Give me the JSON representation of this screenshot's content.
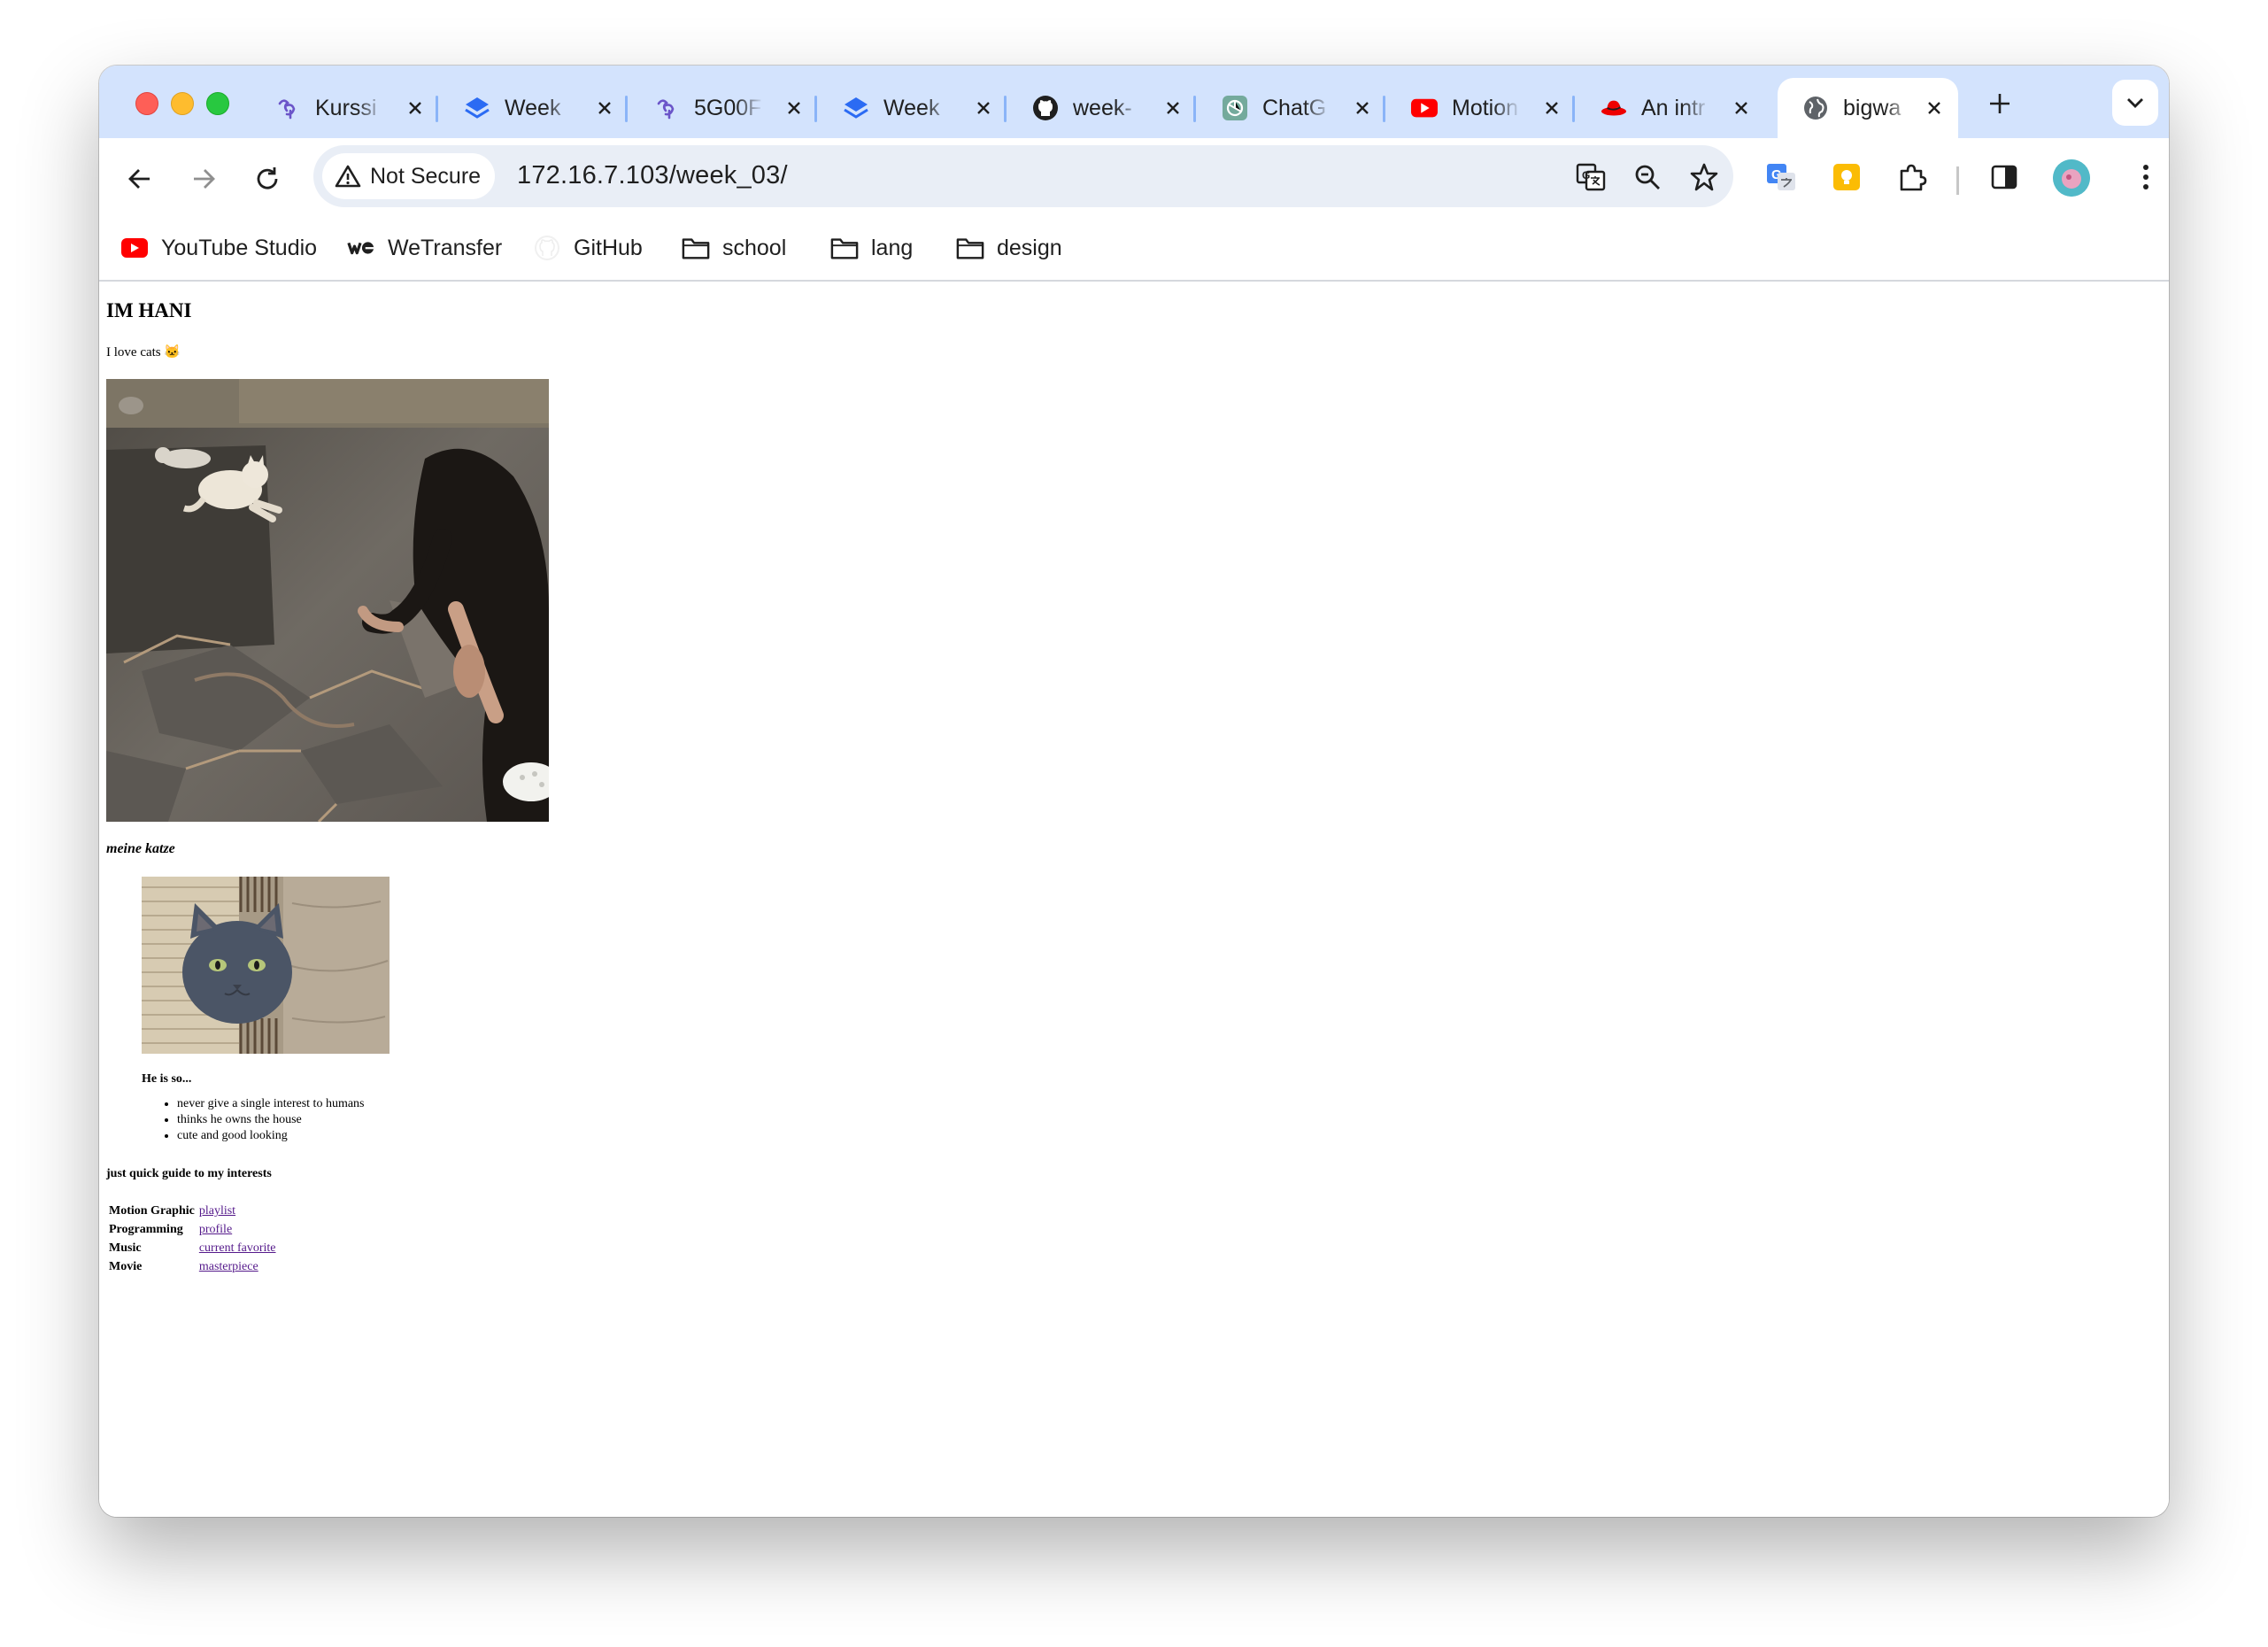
{
  "browser": {
    "tabs": [
      {
        "title": "Kurssi",
        "icon": "sisu-icon"
      },
      {
        "title": "Week",
        "icon": "layers-icon"
      },
      {
        "title": "5G00F",
        "icon": "sisu-icon"
      },
      {
        "title": "Week",
        "icon": "layers-icon"
      },
      {
        "title": "week-",
        "icon": "github-icon"
      },
      {
        "title": "ChatG",
        "icon": "chatgpt-icon"
      },
      {
        "title": "Motion",
        "icon": "youtube-icon"
      },
      {
        "title": "An intr",
        "icon": "redhat-icon"
      },
      {
        "title": "bigwa",
        "icon": "globe-icon",
        "active": true
      }
    ],
    "security_label": "Not Secure",
    "url": "172.16.7.103/week_03/",
    "bookmarks": [
      {
        "label": "YouTube Studio",
        "icon": "youtube-studio-icon"
      },
      {
        "label": "WeTransfer",
        "icon": "wetransfer-icon"
      },
      {
        "label": "GitHub",
        "icon": "github-icon"
      },
      {
        "label": "school",
        "icon": "folder-icon"
      },
      {
        "label": "lang",
        "icon": "folder-icon"
      },
      {
        "label": "design",
        "icon": "folder-icon"
      }
    ],
    "colors": {
      "tabstrip": "#d3e3fd",
      "omnibox": "#e9eef6",
      "link_visited": "#551a8b"
    }
  },
  "page": {
    "heading": "IM HANI",
    "intro": "I love cats 🐱",
    "photo1_caption": "meine katze",
    "photo2_caption": "He is so...",
    "traits": [
      "never give a single interest to humans",
      "thinks he owns the house",
      "cute and good looking"
    ],
    "guide_title": "just quick guide to my interests",
    "interests": [
      {
        "label": "Motion Graphic",
        "link": "playlist"
      },
      {
        "label": "Programming",
        "link": "profile"
      },
      {
        "label": "Music",
        "link": "current favorite"
      },
      {
        "label": "Movie",
        "link": "masterpiece"
      }
    ]
  }
}
